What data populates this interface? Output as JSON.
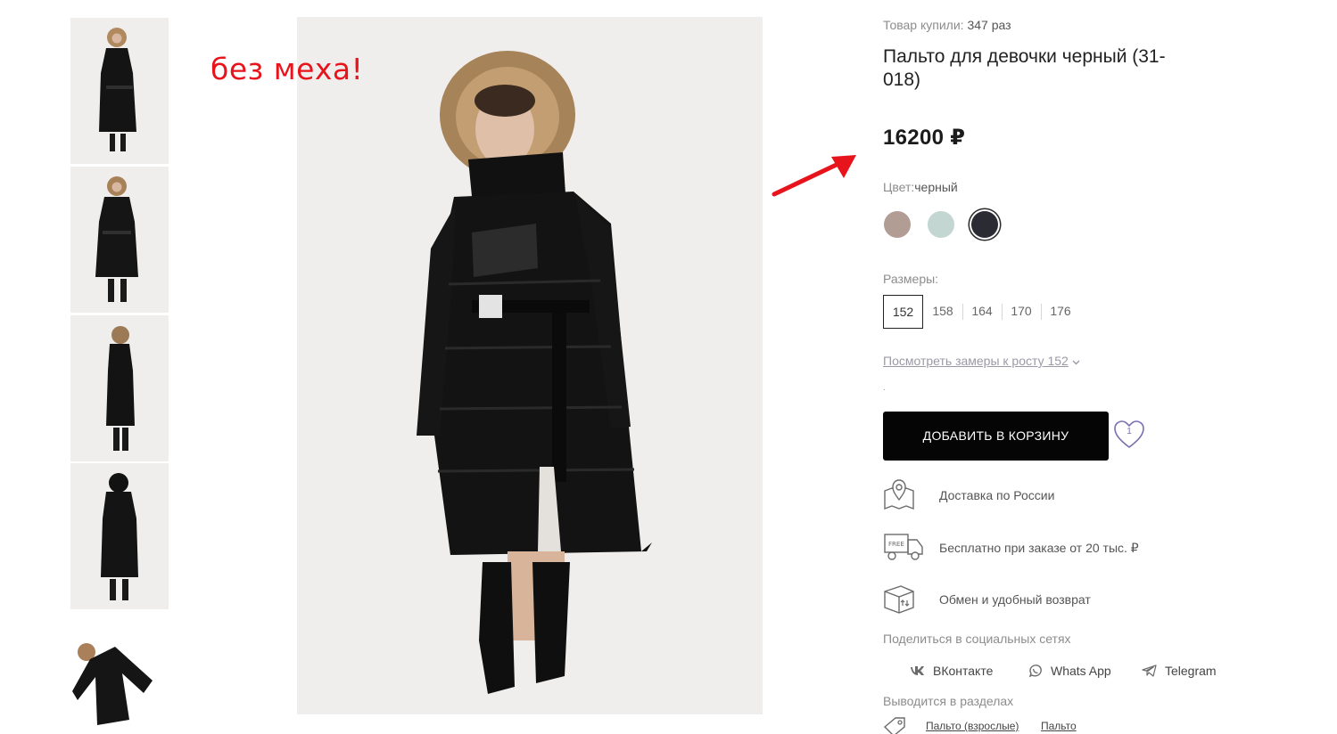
{
  "annotation": {
    "text": "без меха!",
    "color": "#e8141c"
  },
  "product": {
    "bought_label": "Товар купили:",
    "bought_value": "347 раз",
    "title": "Пальто для девочки черный (31-018)",
    "price": "16200 ₽",
    "color_label": "Цвет:",
    "color_value": "черный",
    "swatches": [
      {
        "name": "taupe",
        "color": "#b29d94",
        "selected": false
      },
      {
        "name": "mint",
        "color": "#c4d6d2",
        "selected": false
      },
      {
        "name": "black",
        "color": "#2a2b33",
        "selected": true
      }
    ],
    "sizes_label": "Размеры:",
    "sizes": [
      "152",
      "158",
      "164",
      "170",
      "176"
    ],
    "selected_size": "152",
    "measure_link": "Посмотреть замеры к росту 152",
    "dot": ".",
    "add_to_cart": "ДОБАВИТЬ В КОРЗИНУ",
    "favorites_count": "1"
  },
  "features": [
    {
      "icon": "map-location-icon",
      "text": "Доставка по России"
    },
    {
      "icon": "free-delivery-truck-icon",
      "text": "Бесплатно при заказе от 20 тыс. ₽"
    },
    {
      "icon": "return-box-icon",
      "text": "Обмен и удобный возврат"
    }
  ],
  "share": {
    "label": "Поделиться в социальных сетях",
    "items": [
      {
        "icon": "vk-icon",
        "label": "ВКонтакте"
      },
      {
        "icon": "whatsapp-icon",
        "label": "Whats App"
      },
      {
        "icon": "telegram-icon",
        "label": "Telegram"
      }
    ]
  },
  "sections": {
    "label": "Выводится в разделах",
    "links": [
      "Пальто (взрослые)",
      "Пальто"
    ]
  },
  "thumbnails": [
    {
      "name": "front-hood-up"
    },
    {
      "name": "front-hood-open"
    },
    {
      "name": "side-view"
    },
    {
      "name": "back-view"
    },
    {
      "name": "flat-lay"
    }
  ],
  "icon_colors": {
    "accent": "#7a6fb0",
    "icon": "#6b6b6b"
  }
}
